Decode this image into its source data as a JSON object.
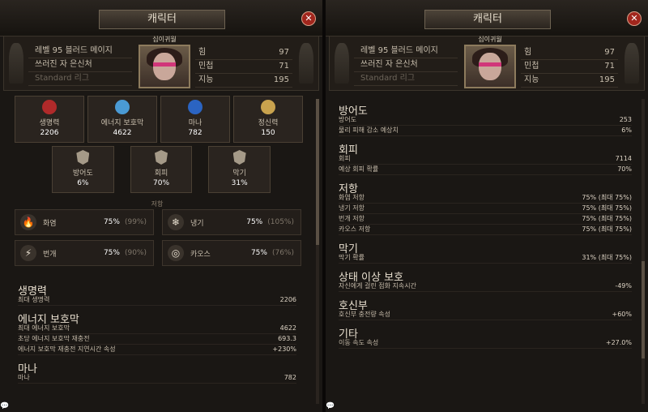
{
  "window_title": "캐릭터",
  "portrait_title": "십이귀월",
  "char": {
    "level_class": "레벨 95 블러드 메이지",
    "title": "쓰러진 자 은신처",
    "league": "Standard 리그"
  },
  "attributes": [
    {
      "name": "힘",
      "value": "97"
    },
    {
      "name": "민첩",
      "value": "71"
    },
    {
      "name": "지능",
      "value": "195"
    }
  ],
  "stat_boxes": [
    {
      "label": "생명력",
      "value": "2206",
      "color": "#b02a2a"
    },
    {
      "label": "에너지 보호막",
      "value": "4622",
      "color": "#4a9ad4"
    },
    {
      "label": "마나",
      "value": "782",
      "color": "#2b64c2"
    },
    {
      "label": "정신력",
      "value": "150",
      "color": "#c9a34e"
    }
  ],
  "defence_boxes": [
    {
      "label": "방어도",
      "value": "6%"
    },
    {
      "label": "회피",
      "value": "70%"
    },
    {
      "label": "막기",
      "value": "31%"
    }
  ],
  "resistance_title": "저항",
  "resistances": [
    {
      "icon": "🔥",
      "name": "화염",
      "value": "75%",
      "max": "(99%)"
    },
    {
      "icon": "❄",
      "name": "냉기",
      "value": "75%",
      "max": "(105%)"
    },
    {
      "icon": "⚡",
      "name": "번개",
      "value": "75%",
      "max": "(90%)"
    },
    {
      "icon": "◎",
      "name": "카오스",
      "value": "75%",
      "max": "(76%)"
    }
  ],
  "left_sections": [
    {
      "title": "생명력",
      "rows": [
        {
          "label": "최대 생명력",
          "value": "2206"
        }
      ]
    },
    {
      "title": "에너지 보호막",
      "rows": [
        {
          "label": "최대 에너지 보호막",
          "value": "4622"
        },
        {
          "label": "초당 에너지 보호막 재충전",
          "value": "693.3"
        },
        {
          "label": "에너지 보호막 재충전 지연시간 속성",
          "value": "+230%"
        }
      ]
    },
    {
      "title": "마나",
      "rows": [
        {
          "label": "마나",
          "value": "782"
        }
      ]
    }
  ],
  "right_sections": [
    {
      "title": "방어도",
      "rows": [
        {
          "label": "방어도",
          "value": "253"
        },
        {
          "label": "물리 피해 감소 예상치",
          "value": "6%"
        }
      ]
    },
    {
      "title": "회피",
      "rows": [
        {
          "label": "회피",
          "value": "7114"
        },
        {
          "label": "예상 회피 확률",
          "value": "70%"
        }
      ]
    },
    {
      "title": "저항",
      "rows": [
        {
          "label": "화염 저항",
          "value": "75% (최대 75%)"
        },
        {
          "label": "냉기 저항",
          "value": "75% (최대 75%)"
        },
        {
          "label": "번개 저항",
          "value": "75% (최대 75%)"
        },
        {
          "label": "카오스 저항",
          "value": "75% (최대 75%)"
        }
      ]
    },
    {
      "title": "막기",
      "rows": [
        {
          "label": "막기 확률",
          "value": "31% (최대 75%)"
        }
      ]
    },
    {
      "title": "상태 이상 보호",
      "rows": [
        {
          "label": "자신에게 걸린 점화 지속시간",
          "value": "-49%"
        }
      ]
    },
    {
      "title": "호신부",
      "rows": [
        {
          "label": "호신부 충전량 속성",
          "value": "+60%"
        }
      ]
    },
    {
      "title": "기타",
      "rows": [
        {
          "label": "이동 속도 속성",
          "value": "+27.0%"
        }
      ]
    }
  ],
  "close_glyph": "✕",
  "chat_glyph": "💬"
}
